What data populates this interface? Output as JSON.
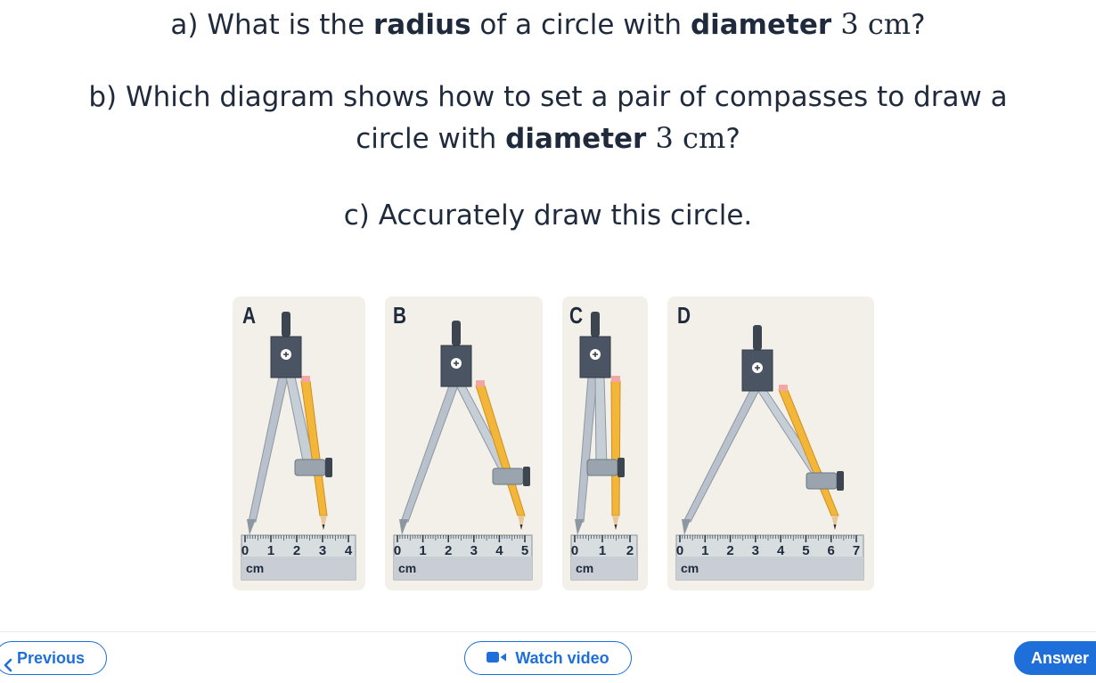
{
  "questions": {
    "a": {
      "pre": "a) What is the ",
      "b1": "radius",
      "mid": " of a circle with ",
      "b2": "diameter",
      "math": " 3 cm",
      "post": "?"
    },
    "b": {
      "line1": "b) Which diagram shows how to set a pair of compasses to draw a",
      "pre2": "circle with ",
      "b1": "diameter",
      "math": " 3 cm",
      "post": "?"
    },
    "c": {
      "text": "c) Accurately draw this circle."
    }
  },
  "options": [
    {
      "letter": "A",
      "ticks": [
        "0",
        "1",
        "2",
        "3",
        "4"
      ],
      "unit": "cm"
    },
    {
      "letter": "B",
      "ticks": [
        "0",
        "1",
        "2",
        "3",
        "4",
        "5"
      ],
      "unit": "cm"
    },
    {
      "letter": "C",
      "ticks": [
        "0",
        "1",
        "2"
      ],
      "unit": "cm"
    },
    {
      "letter": "D",
      "ticks": [
        "0",
        "1",
        "2",
        "3",
        "4",
        "5",
        "6",
        "7"
      ],
      "unit": "cm"
    }
  ],
  "footer": {
    "previous_label": "Previous",
    "watch_video_label": "Watch video",
    "answer_label": "Answer"
  },
  "colors": {
    "accent": "#1e6fd9",
    "card_bg": "#f3f0ea",
    "text": "#1f2b3d"
  },
  "icons": {
    "previous": "chevron-left-icon",
    "video": "video-camera-icon"
  }
}
